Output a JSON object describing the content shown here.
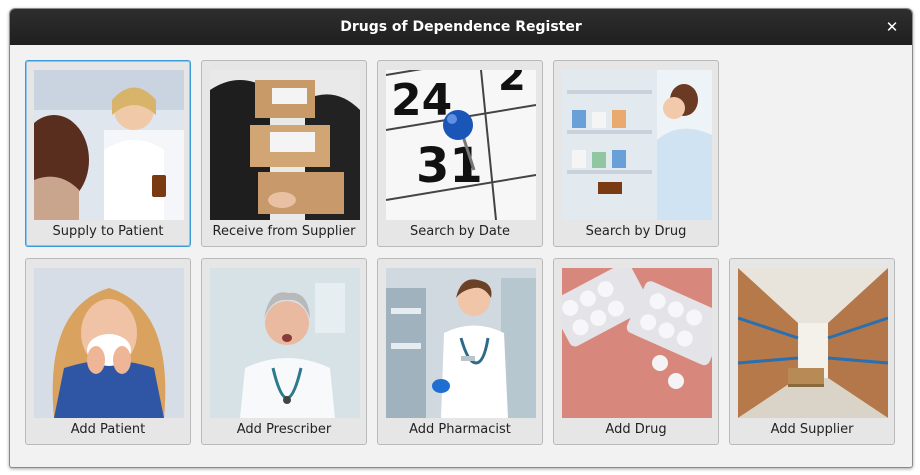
{
  "window": {
    "title": "Drugs of Dependence Register"
  },
  "tiles": [
    {
      "label": "Supply to Patient",
      "icon": "pharmacist-consultation-photo"
    },
    {
      "label": "Receive from Supplier",
      "icon": "delivery-boxes-photo"
    },
    {
      "label": "Search by Date",
      "icon": "calendar-pin-photo"
    },
    {
      "label": "Search by Drug",
      "icon": "pharmacy-shelf-photo"
    },
    {
      "label": "Add Patient",
      "icon": "sick-patient-photo"
    },
    {
      "label": "Add Prescriber",
      "icon": "doctor-photo"
    },
    {
      "label": "Add Pharmacist",
      "icon": "pharmacist-photo"
    },
    {
      "label": "Add Drug",
      "icon": "pill-blister-photo"
    },
    {
      "label": "Add Supplier",
      "icon": "warehouse-photo"
    }
  ]
}
